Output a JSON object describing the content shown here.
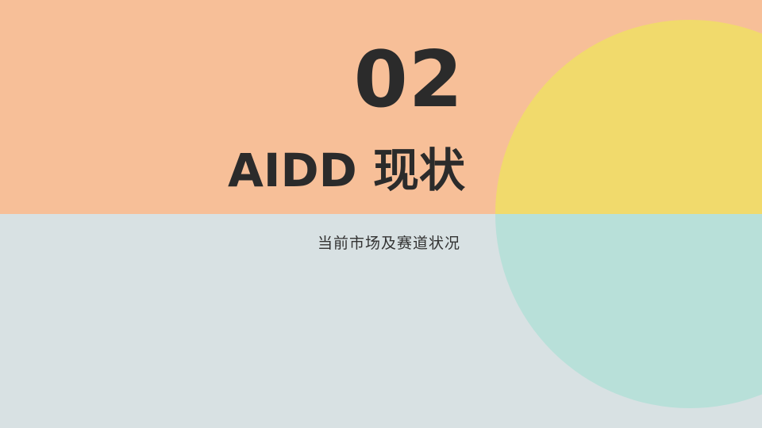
{
  "slide": {
    "number": "02",
    "title": "AIDD 现状",
    "subtitle": "当前市场及赛道状况"
  },
  "colors": {
    "top_band": "#f7bf98",
    "bottom_band": "#d8e1e3",
    "circle_top": "#f1da6c",
    "circle_bottom": "#b8e0d9",
    "title_text": "#2b2b2b",
    "subtitle_text": "#333333"
  }
}
